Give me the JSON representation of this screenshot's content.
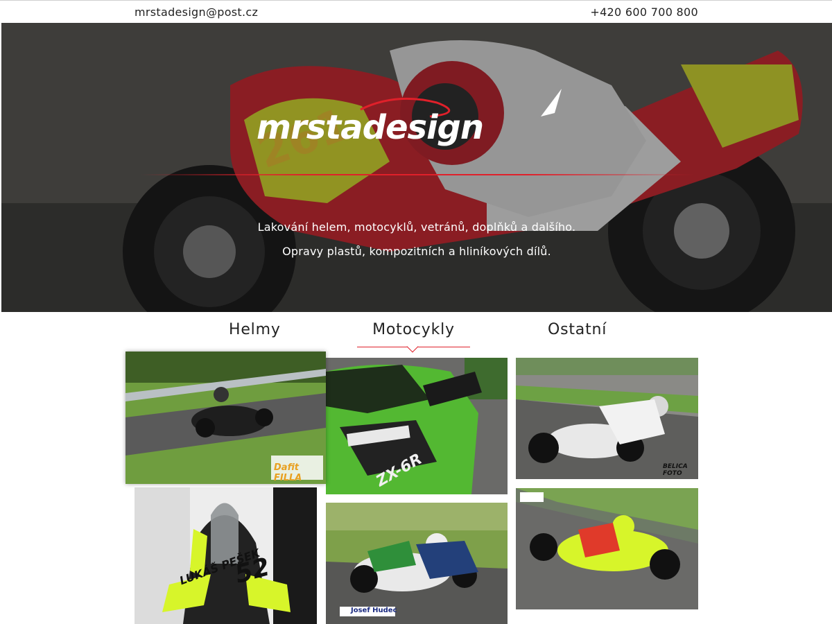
{
  "contact": {
    "email": "mrstadesign@post.cz",
    "phone": "+420 600 700 800"
  },
  "hero": {
    "logo_text": "mrstadesign",
    "tagline_1": "Lakování helem, motocyklů, vetránů, doplňků a dalšího.",
    "tagline_2": "Opravy plastů, kompozitních a hliníkových dílů."
  },
  "tabs": [
    {
      "label": "Helmy",
      "active": false
    },
    {
      "label": "Motocykly",
      "active": true
    },
    {
      "label": "Ostatní",
      "active": false
    }
  ],
  "colors": {
    "accent": "#e0202a",
    "text": "#222222",
    "background": "#ffffff"
  },
  "gallery": {
    "watermarks": {
      "p1": "Dafit FILLA",
      "p3": "BELICA FOTO",
      "p4_number": "52",
      "p4_name": "LUKÁŠ PEŠEK",
      "p5": "Josef Hudec",
      "p2_model": "ZX-6R"
    }
  }
}
